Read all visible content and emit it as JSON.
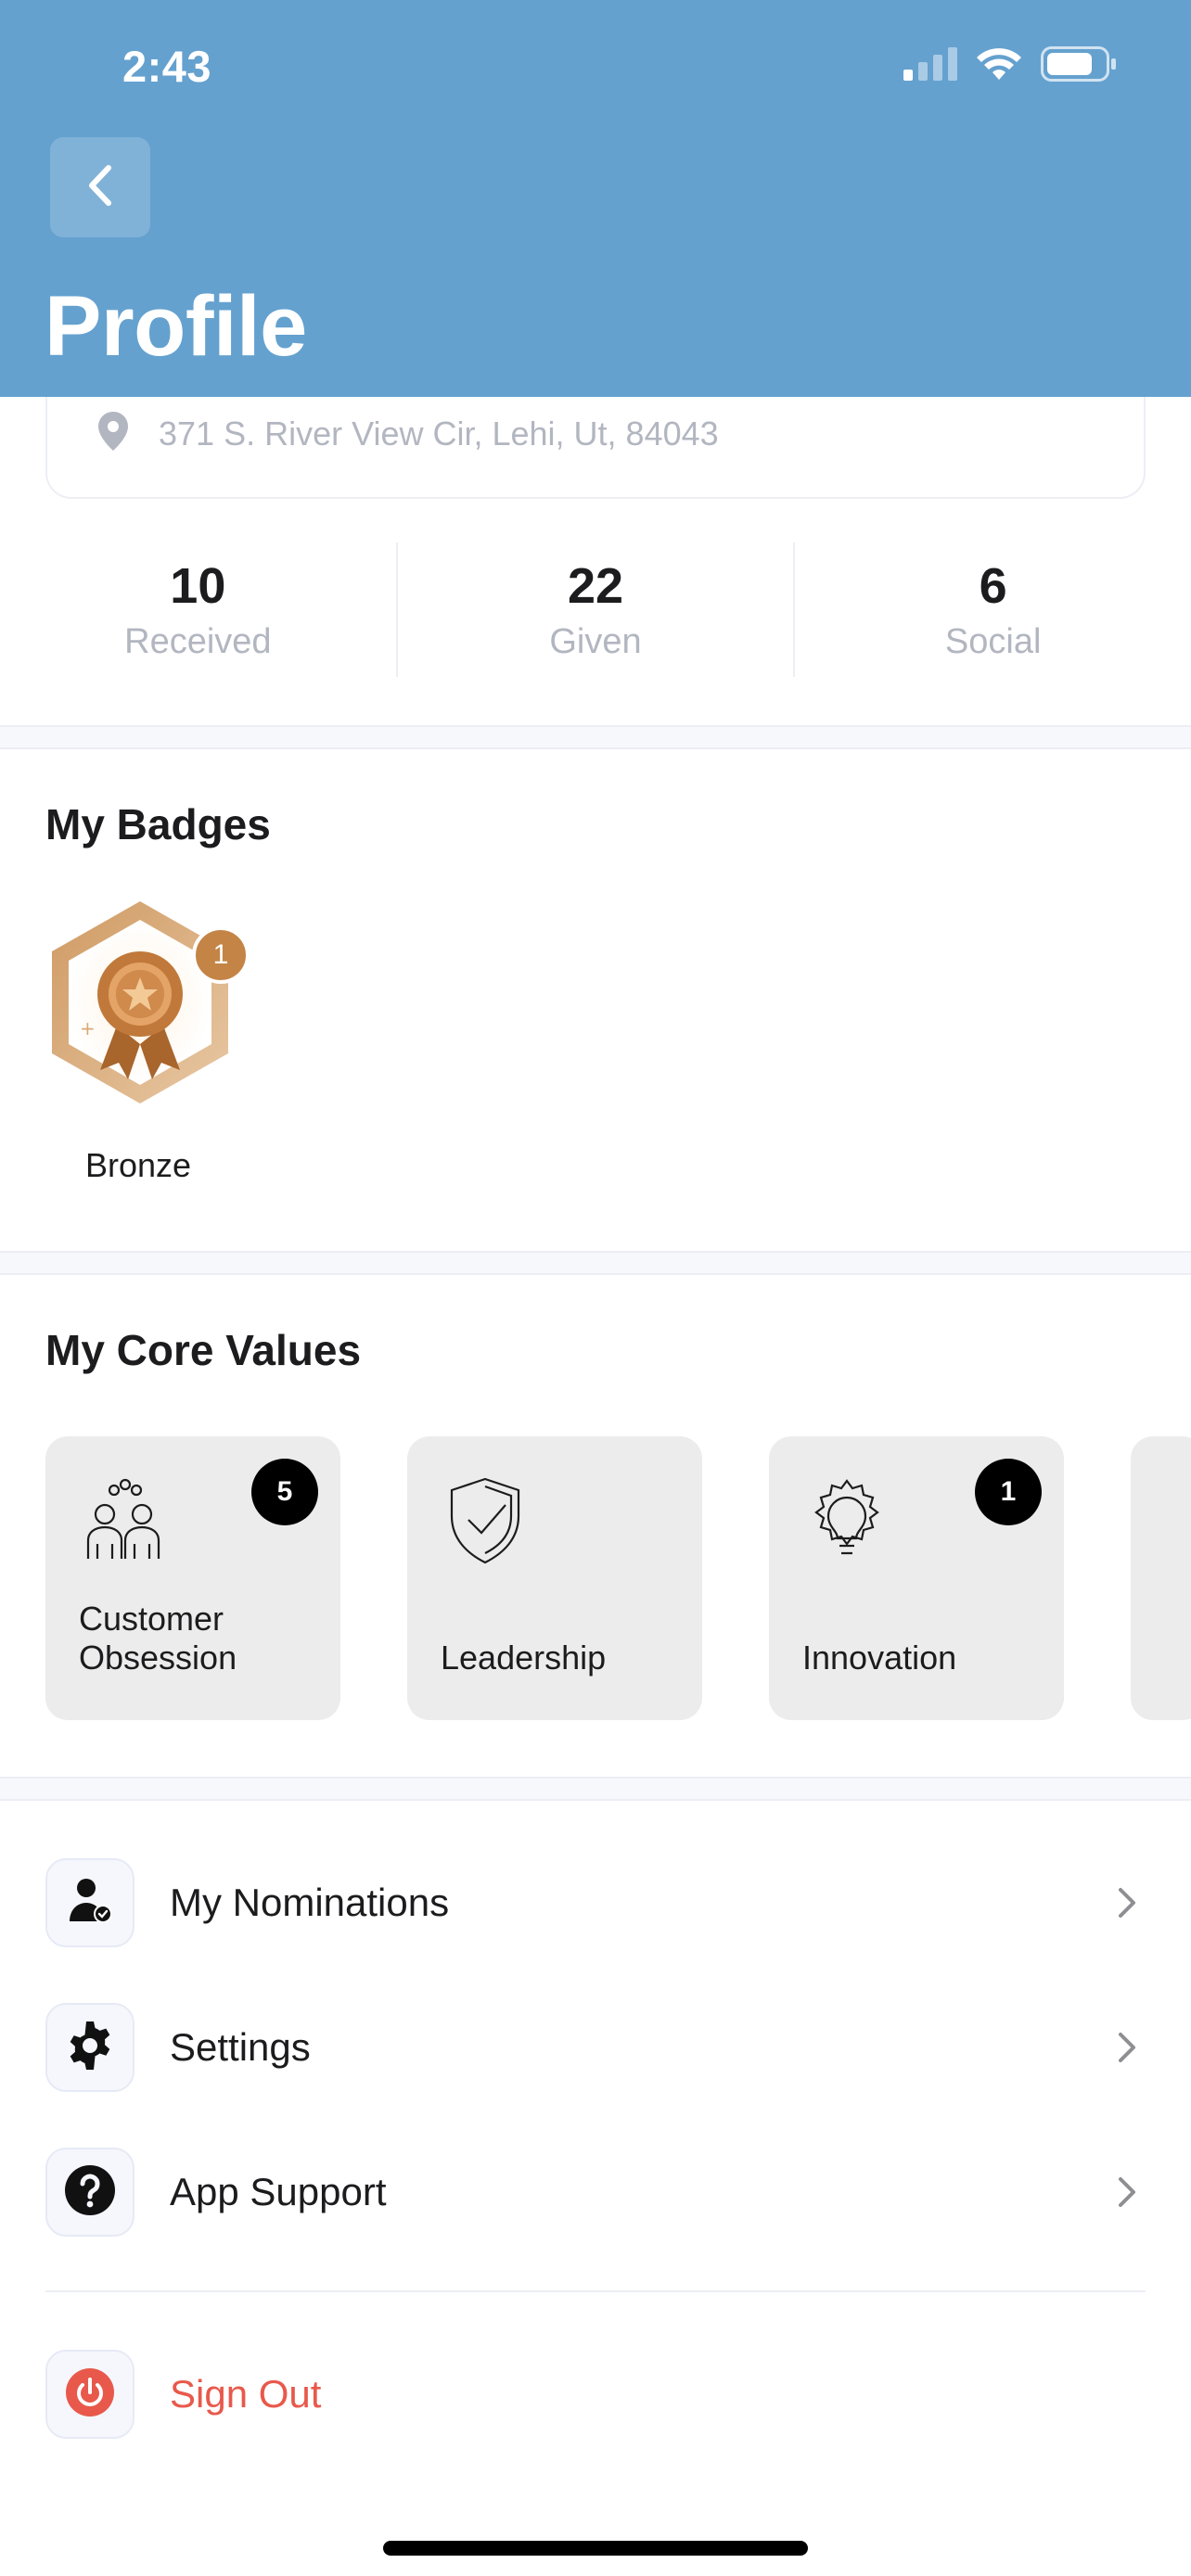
{
  "status_bar": {
    "time": "2:43"
  },
  "header": {
    "title": "Profile"
  },
  "address": "371 S. River View Cir, Lehi, Ut, 84043",
  "stats": [
    {
      "value": "10",
      "label": "Received"
    },
    {
      "value": "22",
      "label": "Given"
    },
    {
      "value": "6",
      "label": "Social"
    }
  ],
  "badges": {
    "title": "My Badges",
    "items": [
      {
        "name": "Bronze",
        "count": "1",
        "color": "#c48445"
      }
    ]
  },
  "core_values": {
    "title": "My Core Values",
    "items": [
      {
        "label_line1": "Customer",
        "label_line2": "Obsession",
        "count": "5",
        "icon": "team-icon"
      },
      {
        "label_line1": "Leadership",
        "label_line2": "",
        "count": "",
        "icon": "shield-check-icon"
      },
      {
        "label_line1": "Innovation",
        "label_line2": "",
        "count": "1",
        "icon": "lightbulb-gear-icon"
      }
    ]
  },
  "menu": {
    "items": [
      {
        "label": "My Nominations",
        "icon": "user-check-icon"
      },
      {
        "label": "Settings",
        "icon": "gear-icon"
      },
      {
        "label": "App Support",
        "icon": "help-icon"
      }
    ],
    "sign_out": {
      "label": "Sign Out",
      "icon": "power-icon",
      "color": "#e8594b"
    }
  },
  "colors": {
    "header": "#64a1cf",
    "badge_bronze": "#c48445",
    "sign_out": "#e8594b"
  }
}
